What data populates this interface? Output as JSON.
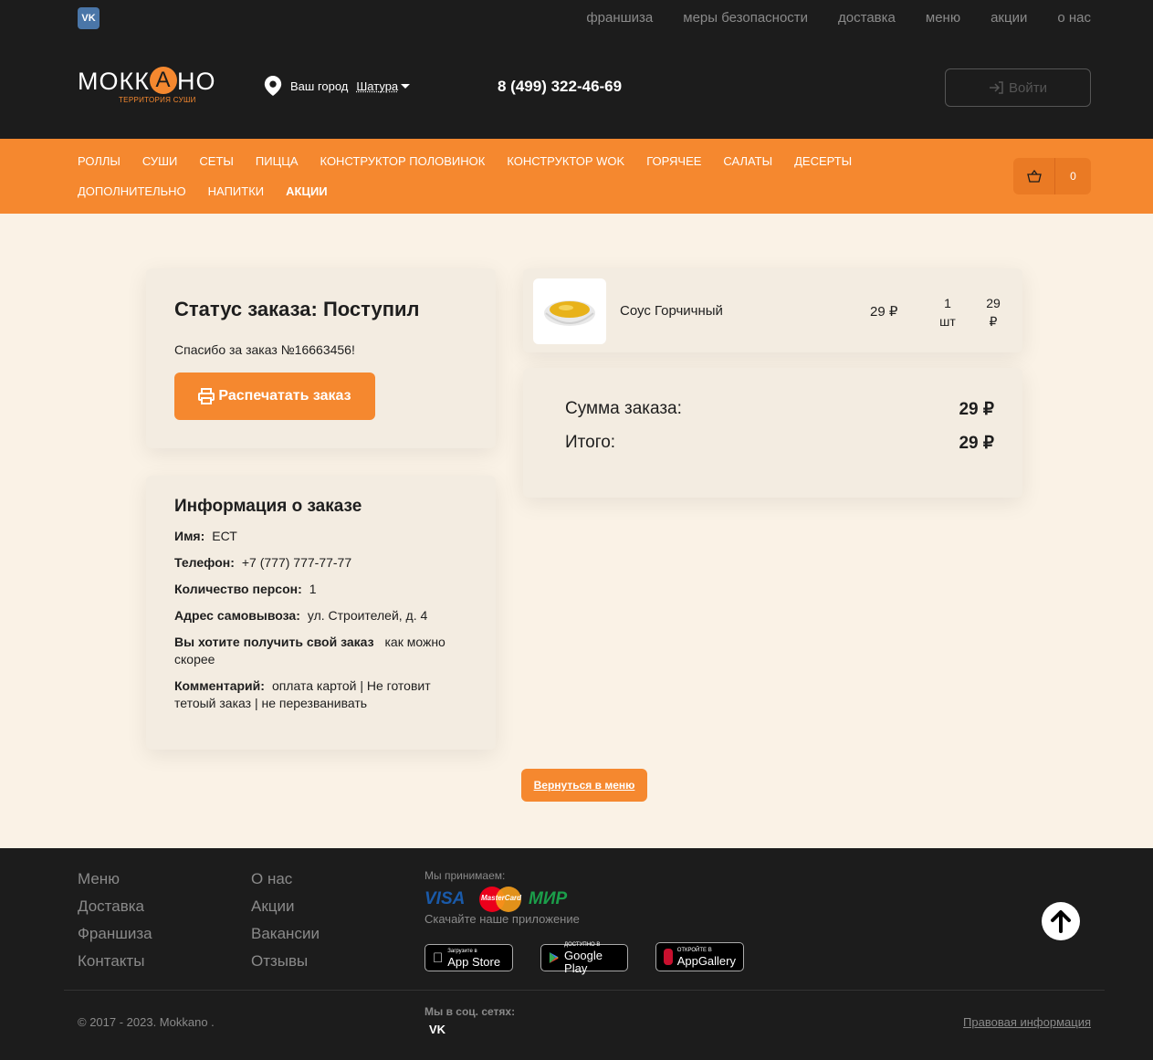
{
  "topbar": {
    "vk": "VK",
    "nav": [
      "франшиза",
      "меры безопасности",
      "доставка",
      "меню",
      "акции",
      "о нас"
    ]
  },
  "header": {
    "logo_text": "МОКК",
    "logo_a": "А",
    "logo_end": "НО",
    "logo_sub": "ТЕРРИТОРИЯ СУШИ",
    "city_label": "Ваш город",
    "city_name": "Шатура",
    "phone": "8 (499) 322-46-69",
    "login": "Войти"
  },
  "categories": {
    "row1": [
      "РОЛЛЫ",
      "СУШИ",
      "СЕТЫ",
      "ПИЦЦА",
      "КОНСТРУКТОР ПОЛОВИНОК",
      "КОНСТРУКТОР WOK",
      "ГОРЯЧЕЕ",
      "САЛАТЫ",
      "ДЕСЕРТЫ"
    ],
    "row2": [
      "ДОПОЛНИТЕЛЬНО",
      "НАПИТКИ",
      "АКЦИИ"
    ],
    "cart_count": "0"
  },
  "order_status": {
    "title": "Статус заказа: Поступил",
    "thanks": "Спасибо за заказ №16663456!",
    "print": "Распечатать заказ"
  },
  "order_info": {
    "title": "Информация о заказе",
    "rows": [
      {
        "label": "Имя:",
        "value": "ЕСТ"
      },
      {
        "label": "Телефон:",
        "value": "+7 (777) 777-77-77"
      },
      {
        "label": "Количество персон:",
        "value": "1"
      },
      {
        "label": "Адрес самовывоза:",
        "value": "ул. Строителей, д. 4"
      },
      {
        "label": "Вы хотите получить свой заказ",
        "value": "как можно скорее"
      },
      {
        "label": "Комментарий:",
        "value": "оплата картой | Не готовит тетоый заказ | не перезванивать"
      }
    ]
  },
  "item": {
    "name": "Соус Горчичный",
    "price": "29 ₽",
    "qty": "1",
    "qty_unit": "шт",
    "total": "29",
    "total_cur": "₽"
  },
  "summary": {
    "sum_label": "Сумма заказа:",
    "sum_value": "29 ₽",
    "total_label": "Итого:",
    "total_value": "29 ₽"
  },
  "back": "Вернуться в меню",
  "footer": {
    "col1": [
      "Меню",
      "Доставка",
      "Франшиза",
      "Контакты"
    ],
    "col2": [
      "О нас",
      "Акции",
      "Вакансии",
      "Отзывы"
    ],
    "pay_label": "Мы принимаем:",
    "visa": "VISA",
    "mastercard": "MasterCard",
    "mir": "МИР",
    "app_label": "Скачайте наше приложение",
    "appstore_small": "Загрузите в",
    "appstore_big": "App Store",
    "gplay_small": "ДОСТУПНО В",
    "gplay_big": "Google Play",
    "appgallery_small": "ОТКРОЙТЕ В",
    "appgallery_big": "AppGallery",
    "copyright": "© 2017 - 2023. Mokkano .",
    "social_label": "Мы в соц. сетях:",
    "social_vk": "VK",
    "legal": "Правовая информация"
  },
  "colors": {
    "accent": "#f5882f",
    "dark": "#1c1c1c",
    "background": "#faf2e6"
  }
}
